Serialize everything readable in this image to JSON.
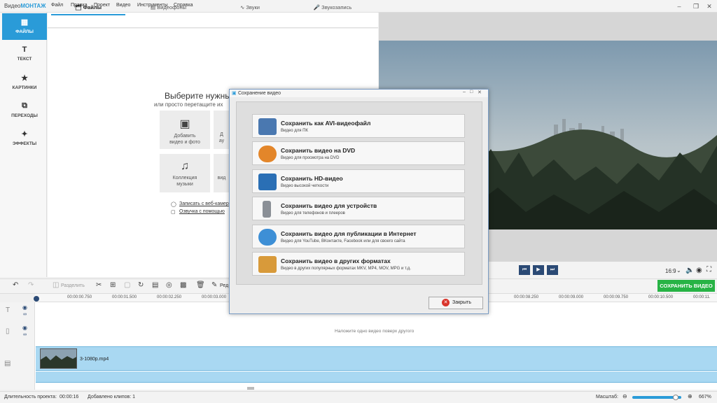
{
  "app": {
    "logo_prefix": "Видео",
    "logo_brand": "МОНТАЖ"
  },
  "menu": [
    "Файл",
    "Правка",
    "Проект",
    "Видео",
    "Инструменты",
    "Справка"
  ],
  "sidebar": {
    "items": [
      {
        "label": "ФАЙЛЫ",
        "icon": "files-icon"
      },
      {
        "label": "ТЕКСТ",
        "icon": "text-icon"
      },
      {
        "label": "КАРТИНКИ",
        "icon": "star-icon"
      },
      {
        "label": "ПЕРЕХОДЫ",
        "icon": "transitions-icon"
      },
      {
        "label": "ЭФФЕКТЫ",
        "icon": "magic-wand-icon"
      }
    ]
  },
  "tabs": [
    "Файлы",
    "Видеофоны",
    "Звуки",
    "Звукозапись"
  ],
  "content": {
    "title": "Выберите нужны",
    "subtitle": "или просто перетащите их",
    "tiles": [
      {
        "label1": "Добавить",
        "label2": "видео и фото"
      },
      {
        "label1": "Д",
        "label2": "ау"
      },
      {
        "label1": "Коллекция",
        "label2": "музыки"
      },
      {
        "label1": "",
        "label2": "вид"
      }
    ],
    "link_webcam": "Записать с веб-камер",
    "link_voice": "Озвучка с помощью"
  },
  "preview": {
    "ratio": "16:9"
  },
  "toolbar": {
    "split": "Разделить",
    "edit": "Ред",
    "save_video": "СОХРАНИТЬ ВИДЕО"
  },
  "timeline": {
    "ticks": [
      "00:00:00.750",
      "00:00:01.500",
      "00:00:02.250",
      "00:00:03.000",
      "00:00:08.250",
      "00:00:09.000",
      "00:00:09.750",
      "00:00:10.500",
      "00:00:11."
    ],
    "overlay_hint": "Наложите одно видео поверх другого",
    "clip_name": "3-1080p.mp4"
  },
  "status": {
    "duration_label": "Длительность проекта:",
    "duration_value": "00:00:16",
    "clips": "Добавлено клипов: 1",
    "zoom_label": "Масштаб:",
    "zoom_value": "667%"
  },
  "dialog": {
    "title": "Сохранение видео",
    "options": [
      {
        "title": "Сохранить как AVI-видеофайл",
        "desc": "Видео для ПК",
        "icon": "avi-file-icon",
        "color": "#4a78b0"
      },
      {
        "title": "Сохранить видео на DVD",
        "desc": "Видео для просмотра на DVD",
        "icon": "dvd-disc-icon",
        "color": "#e3862a"
      },
      {
        "title": "Сохранить HD-видео",
        "desc": "Видео высокой четкости",
        "icon": "hd-monitor-icon",
        "color": "#2a6fb5"
      },
      {
        "title": "Сохранить видео для устройств",
        "desc": "Видео для телефонов и плееров",
        "icon": "phone-icon",
        "color": "#8a8f96"
      },
      {
        "title": "Сохранить видео для публикации в Интернет",
        "desc": "Видео для YouTube, ВКонтакте, Facebook или для своего сайта",
        "icon": "globe-icon",
        "color": "#3d8fd6"
      },
      {
        "title": "Сохранить видео в других форматах",
        "desc": "Видео в других популярных форматах MKV, MP4, MOV, MPG и т.д.",
        "icon": "formats-icon",
        "color": "#d89a3a"
      }
    ],
    "close_label": "Закрыть"
  }
}
